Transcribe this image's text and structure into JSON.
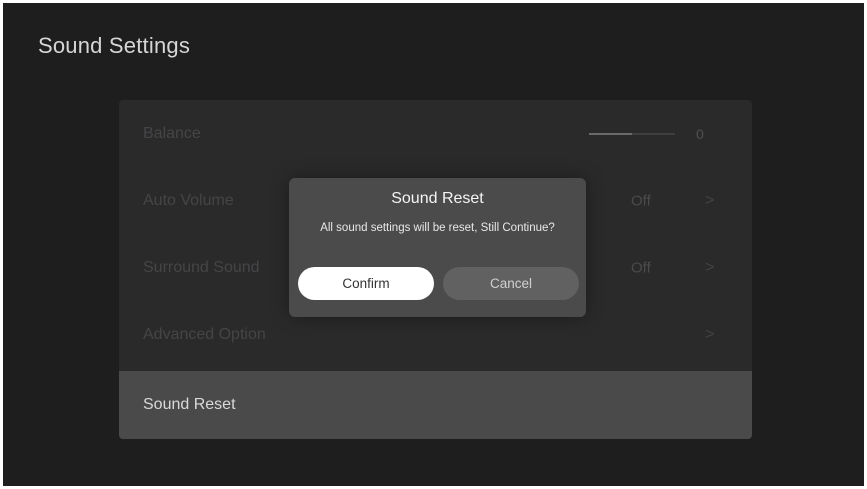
{
  "header": {
    "title": "Sound Settings"
  },
  "settings": {
    "balance": {
      "label": "Balance",
      "value": "0",
      "level": 0.5
    },
    "auto_volume": {
      "label": "Auto Volume",
      "value": "Off",
      "chevron": ">"
    },
    "surround_sound": {
      "label": "Surround Sound",
      "value": "Off",
      "chevron": ">"
    },
    "advanced_option": {
      "label": "Advanced Option",
      "chevron": ">"
    },
    "sound_reset": {
      "label": "Sound Reset"
    }
  },
  "dialog": {
    "title": "Sound Reset",
    "message": "All sound settings will be reset, Still Continue?",
    "confirm_label": "Confirm",
    "cancel_label": "Cancel"
  },
  "colors": {
    "background": "#1f1e1f",
    "panel": "#2a2a2b",
    "selected_row": "#4a4a4b",
    "dialog": "#4b4b4c",
    "confirm_button": "#ffffff",
    "cancel_button": "#616162"
  }
}
